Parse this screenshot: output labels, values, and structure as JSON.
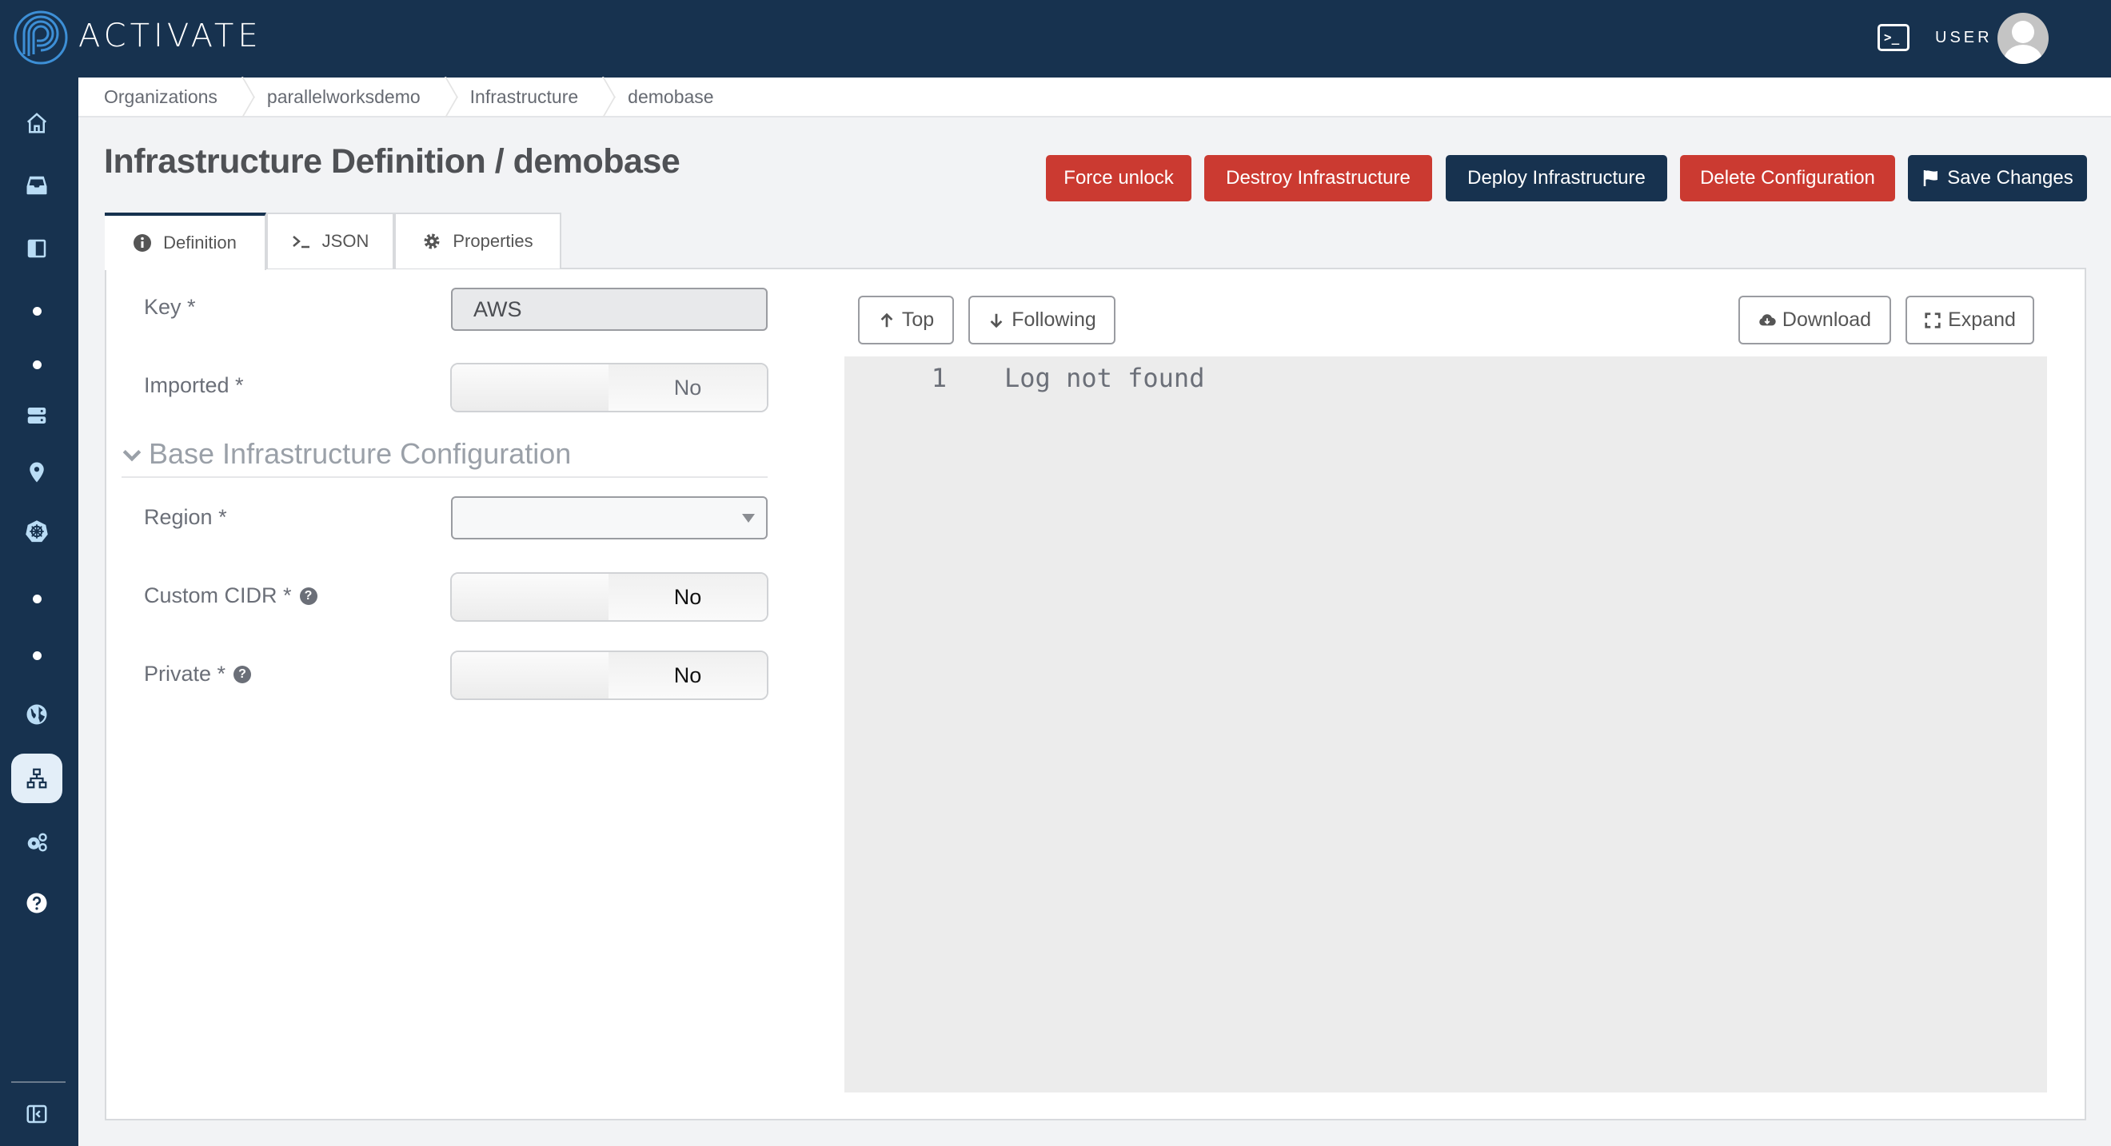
{
  "app": {
    "brand": "ACTIVATE",
    "user_label": "USER"
  },
  "icons": {
    "logo": "activate-logo-icon",
    "terminal": "terminal-icon",
    "avatar": "user-avatar-icon"
  },
  "sidebar": {
    "items": [
      {
        "name": "home",
        "icon": "home-icon",
        "active": false
      },
      {
        "name": "inbox",
        "icon": "inbox-icon",
        "active": false
      },
      {
        "name": "panel",
        "icon": "sidebar-panel-icon",
        "active": false
      },
      {
        "name": "dot-1",
        "icon": "dot-icon",
        "active": false
      },
      {
        "name": "dot-2",
        "icon": "dot-icon",
        "active": false
      },
      {
        "name": "storage",
        "icon": "server-icon",
        "active": false
      },
      {
        "name": "location",
        "icon": "map-pin-icon",
        "active": false
      },
      {
        "name": "kubernetes",
        "icon": "helm-wheel-icon",
        "active": false
      },
      {
        "name": "dot-3",
        "icon": "dot-icon",
        "active": false
      },
      {
        "name": "dot-4",
        "icon": "dot-icon",
        "active": false
      },
      {
        "name": "globe",
        "icon": "globe-icon",
        "active": false
      },
      {
        "name": "infrastructure",
        "icon": "sitemap-icon",
        "active": true
      },
      {
        "name": "settings",
        "icon": "gears-icon",
        "active": false
      },
      {
        "name": "help",
        "icon": "question-circle-icon",
        "active": false
      }
    ],
    "collapse_icon": "collapse-sidebar-icon"
  },
  "breadcrumb": [
    "Organizations",
    "parallelworksdemo",
    "Infrastructure",
    "demobase"
  ],
  "page": {
    "title": "Infrastructure Definition / demobase"
  },
  "actions": {
    "force_unlock": "Force unlock",
    "destroy": "Destroy Infrastructure",
    "deploy": "Deploy Infrastructure",
    "delete_config": "Delete Configuration",
    "save": "Save Changes"
  },
  "colors": {
    "danger": "#cb3a31",
    "primary": "#17324f",
    "log_bg": "#ececec"
  },
  "tabs": [
    {
      "label": "Definition",
      "icon": "info-circle-icon",
      "active": true
    },
    {
      "label": "JSON",
      "icon": "terminal-prompt-icon",
      "active": false
    },
    {
      "label": "Properties",
      "icon": "gear-icon",
      "active": false
    }
  ],
  "form": {
    "key": {
      "label": "Key *",
      "value": "AWS"
    },
    "imported": {
      "label": "Imported *",
      "value": "No"
    },
    "section": {
      "title": "Base Infrastructure Configuration",
      "expanded": true
    },
    "region": {
      "label": "Region *",
      "value": ""
    },
    "custom_cidr": {
      "label": "Custom CIDR *",
      "value": "No",
      "help": "?"
    },
    "private": {
      "label": "Private *",
      "value": "No",
      "help": "?"
    }
  },
  "log": {
    "buttons": {
      "top": "Top",
      "following": "Following",
      "download": "Download",
      "expand": "Expand"
    },
    "lines": [
      {
        "num": "1",
        "text": "Log not found"
      }
    ]
  }
}
